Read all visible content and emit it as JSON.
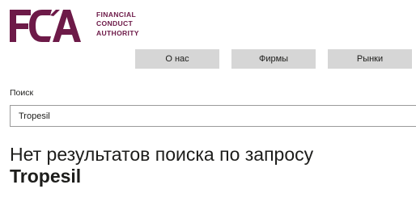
{
  "brand": {
    "logo_letters": "FCA",
    "name_lines": [
      "FINANCIAL",
      "CONDUCT",
      "AUTHORITY"
    ],
    "color": "#6d1a48"
  },
  "nav": {
    "items": [
      {
        "label": "О нас"
      },
      {
        "label": "Фирмы"
      },
      {
        "label": "Рынки"
      }
    ]
  },
  "search": {
    "label": "Поиск",
    "value": "Tropesil"
  },
  "results": {
    "heading_prefix": "Нет результатов поиска по запросу",
    "query": "Tropesil"
  }
}
